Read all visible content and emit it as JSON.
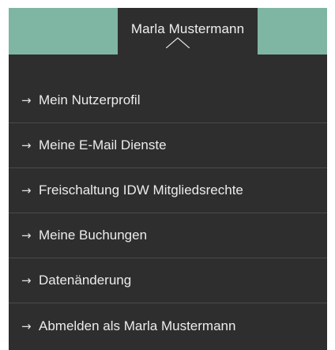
{
  "header": {
    "user_name": "Marla Mustermann",
    "accent_color": "#7fb5a3",
    "panel_color": "#2e2e2e"
  },
  "menu": {
    "items": [
      {
        "icon": "arrow-right-icon",
        "arrow": "→",
        "label": "Mein Nutzerprofil"
      },
      {
        "icon": "arrow-right-icon",
        "arrow": "→",
        "label": "Meine E-Mail Dienste"
      },
      {
        "icon": "arrow-right-icon",
        "arrow": "→",
        "label": "Freischaltung IDW Mitgliedsrechte"
      },
      {
        "icon": "arrow-right-icon",
        "arrow": "→",
        "label": "Meine Buchungen"
      },
      {
        "icon": "arrow-right-icon",
        "arrow": "→",
        "label": "Datenänderung"
      },
      {
        "icon": "arrow-right-icon",
        "arrow": "→",
        "label": "Abmelden als Marla Mustermann"
      }
    ]
  }
}
